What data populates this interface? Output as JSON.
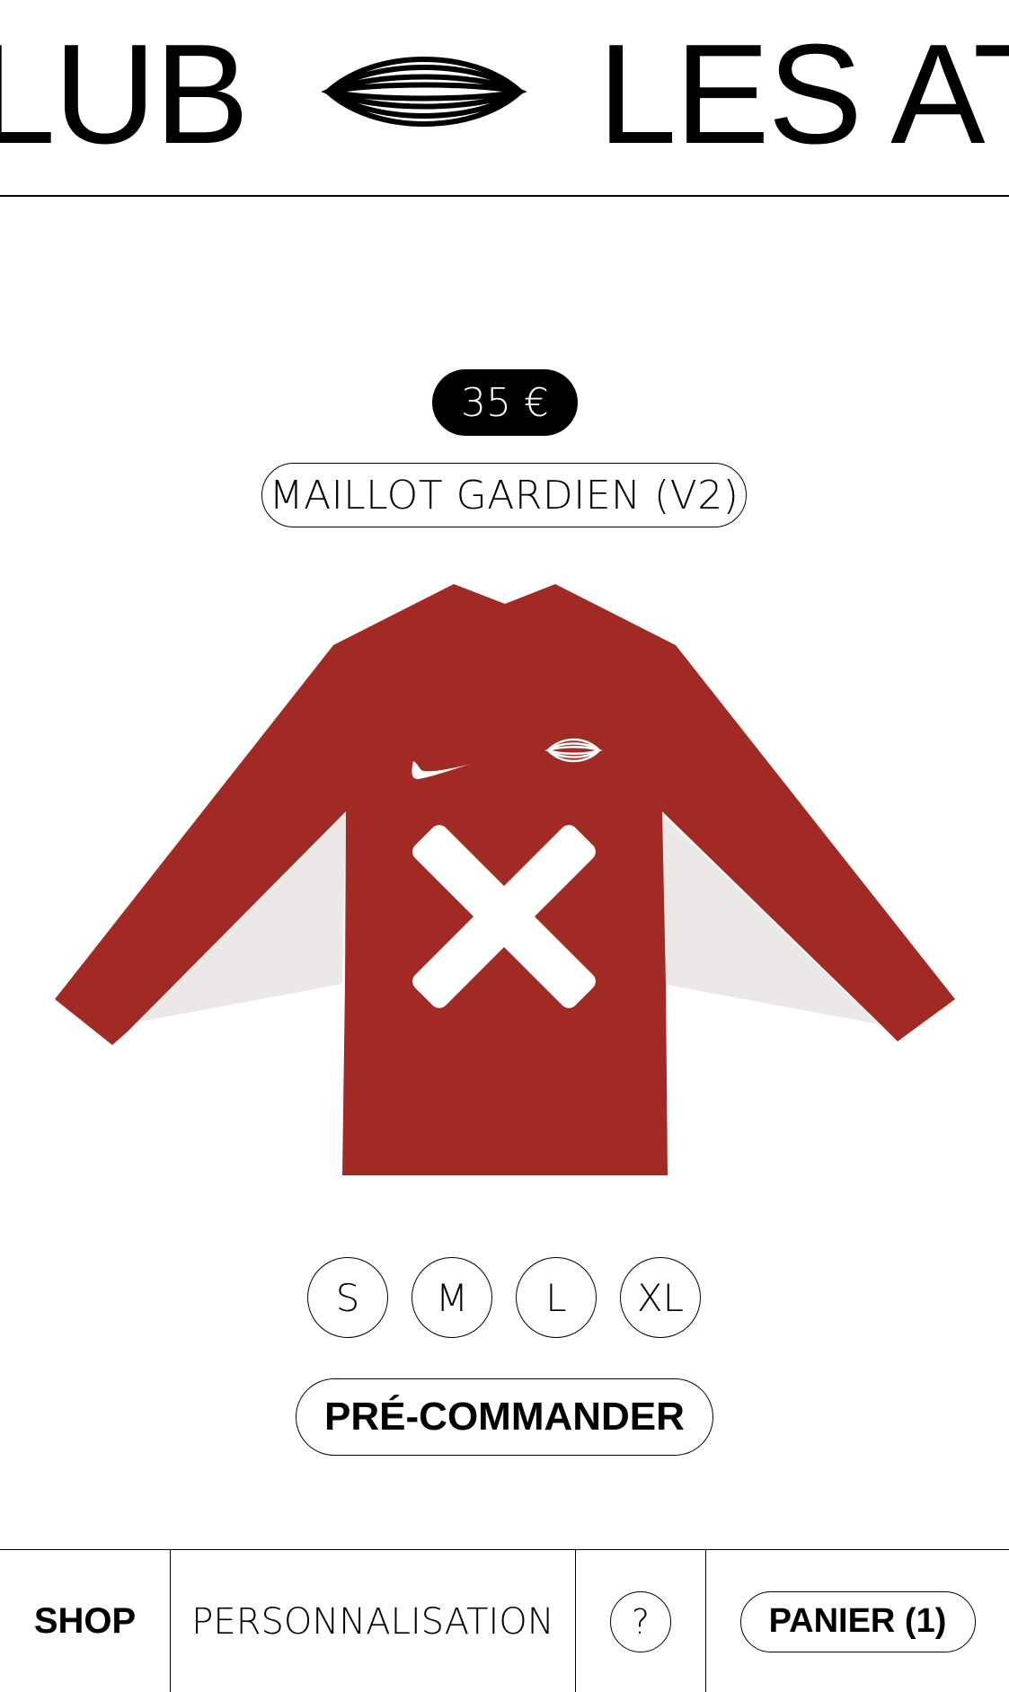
{
  "header": {
    "marquee_left": "LUB",
    "marquee_right": "LES ATE",
    "logo_icon": "club-logo-icon"
  },
  "product": {
    "price": "35 €",
    "name": "MAILLOT GARDIEN (V2)",
    "image_icon": "goalkeeper-jersey-icon",
    "jersey_color": "#A12B24",
    "sizes": [
      "S",
      "M",
      "L",
      "XL"
    ],
    "order_label": "PRÉ-COMMANDER"
  },
  "nav": {
    "shop": "SHOP",
    "personalisation": "PERSONNALISATION",
    "help": "?",
    "cart": "PANIER (1)"
  }
}
